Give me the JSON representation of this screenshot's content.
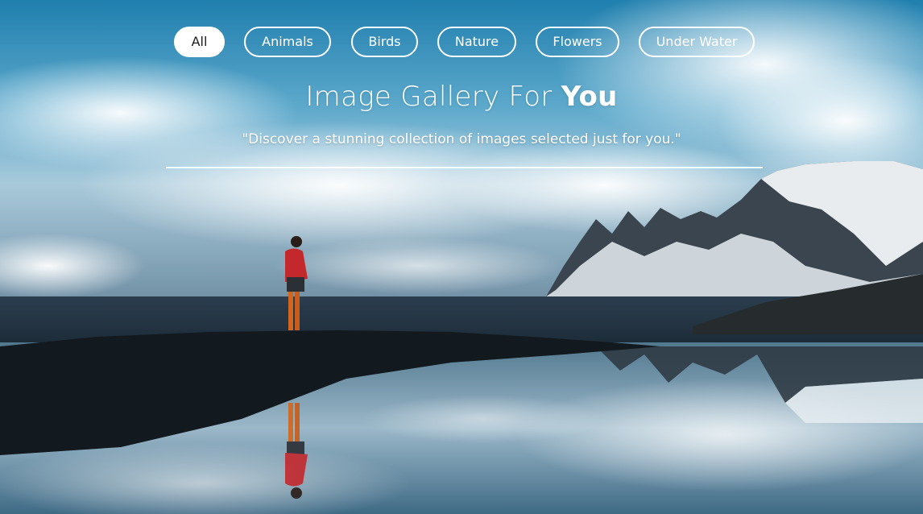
{
  "filters": [
    {
      "label": "All",
      "active": true
    },
    {
      "label": "Animals",
      "active": false
    },
    {
      "label": "Birds",
      "active": false
    },
    {
      "label": "Nature",
      "active": false
    },
    {
      "label": "Flowers",
      "active": false
    },
    {
      "label": "Under Water",
      "active": false
    }
  ],
  "hero": {
    "title_light": "Image Gallery For ",
    "title_bold": "You",
    "subtitle": "\"Discover a stunning collection of images selected just for you.\""
  },
  "colors": {
    "sky_top": "#2f8fb8",
    "water_dark": "#0d1c27",
    "jacket": "#c3282d",
    "pill_border": "#ffffff"
  }
}
